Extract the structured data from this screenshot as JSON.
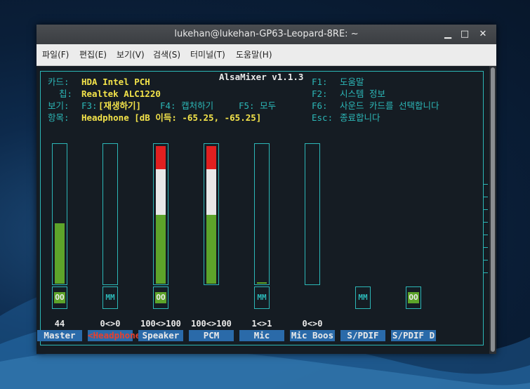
{
  "window": {
    "title": "lukehan@lukehan-GP63-Leopard-8RE: ~"
  },
  "menu": [
    "파일(F)",
    "편집(E)",
    "보기(V)",
    "검색(S)",
    "터미널(T)",
    "도움말(H)"
  ],
  "app": {
    "title": "AlsaMixer v1.1.3",
    "card_label": "카드:",
    "card_value": "HDA Intel PCH",
    "chip_label": "칩:",
    "chip_value": "Realtek ALC1220",
    "view_label": "보기:",
    "view_f3": "F3:",
    "view_f3_value": "[재생하기]",
    "view_f4": "F4: 캡처하기",
    "view_f5": "F5: 모두",
    "item_label": "항목:",
    "item_value": "Headphone [dB 이득: -65.25, -65.25]",
    "help": [
      {
        "key": "F1:",
        "text": "도움말"
      },
      {
        "key": "F2:",
        "text": "시스템 정보"
      },
      {
        "key": "F6:",
        "text": "사운드 카드를 선택합니다"
      },
      {
        "key": "Esc:",
        "text": "종료합니다"
      }
    ]
  },
  "colors": {
    "cyan": "#2cb7b7",
    "yellow": "#f3e34a",
    "green": "#5da42a",
    "red": "#e02020",
    "white": "#e8e8e8",
    "blue": "#2a6aa9"
  },
  "channels": [
    {
      "name": "Master",
      "value": "44",
      "level": 0.44,
      "has_bar": true,
      "switch": "OO",
      "switch_on": true
    },
    {
      "name": "<Headphone>",
      "value": "0<>0",
      "level": 0,
      "has_bar": true,
      "switch": "MM",
      "switch_on": false,
      "selected": true
    },
    {
      "name": "Speaker",
      "value": "100<>100",
      "level": 1.0,
      "has_bar": true,
      "switch": "OO",
      "switch_on": true
    },
    {
      "name": "PCM",
      "value": "100<>100",
      "level": 1.0,
      "has_bar": true,
      "switch": "",
      "switch_on": false
    },
    {
      "name": "Mic",
      "value": "1<>1",
      "level": 0.01,
      "has_bar": true,
      "switch": "MM",
      "switch_on": false
    },
    {
      "name": "Mic Boos",
      "value": "0<>0",
      "level": 0,
      "has_bar": true,
      "switch": "",
      "switch_on": false
    },
    {
      "name": "S/PDIF",
      "value": "",
      "level": null,
      "has_bar": false,
      "switch": "MM",
      "switch_on": false
    },
    {
      "name": "S/PDIF D",
      "value": "",
      "level": null,
      "has_bar": false,
      "switch": "OO",
      "switch_on": true
    }
  ]
}
